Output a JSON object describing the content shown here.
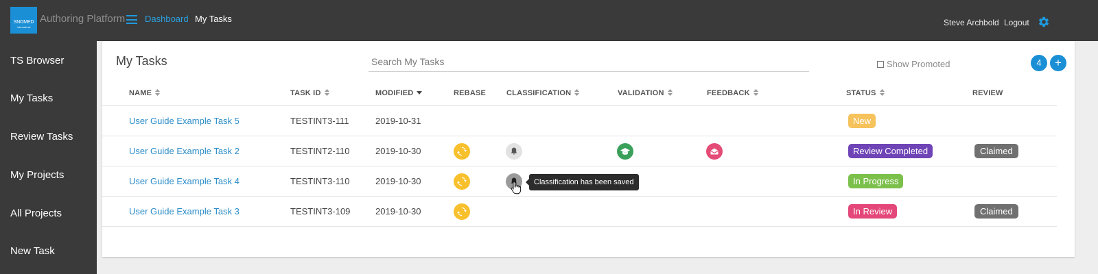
{
  "header": {
    "logo_text": "SNOMED",
    "logo_sub": "International",
    "app_title": "Authoring Platform",
    "nav": {
      "dashboard": "Dashboard",
      "current": "My Tasks"
    },
    "user_name": "Steve Archbold",
    "logout": "Logout",
    "colors": {
      "bar": "#3a3a3a",
      "accent": "#1a8fd6"
    }
  },
  "sidebar": {
    "items": [
      {
        "label": "TS Browser"
      },
      {
        "label": "My Tasks"
      },
      {
        "label": "Review Tasks"
      },
      {
        "label": "My Projects"
      },
      {
        "label": "All Projects"
      },
      {
        "label": "New Task"
      }
    ]
  },
  "main": {
    "title": "My Tasks",
    "search_placeholder": "Search My Tasks",
    "show_promoted_label": "Show Promoted",
    "task_count": "4",
    "add_label": "+",
    "columns": {
      "name": "NAME",
      "task_id": "TASK ID",
      "modified": "MODIFIED",
      "rebase": "REBASE",
      "classification": "CLASSIFICATION",
      "validation": "VALIDATION",
      "feedback": "FEEDBACK",
      "status": "STATUS",
      "review": "REVIEW"
    },
    "rows": [
      {
        "name": "User Guide Example Task 5",
        "task_id": "TESTINT3-111",
        "modified": "2019-10-31",
        "status": "New",
        "status_color": "#f6c25c"
      },
      {
        "name": "User Guide Example Task 2",
        "task_id": "TESTINT2-110",
        "modified": "2019-10-30",
        "status": "Review Completed",
        "status_color": "#6f44b6",
        "review": "Claimed"
      },
      {
        "name": "User Guide Example Task 4",
        "task_id": "TESTINT3-110",
        "modified": "2019-10-30",
        "status": "In Progress",
        "status_color": "#7cc04c"
      },
      {
        "name": "User Guide Example Task 3",
        "task_id": "TESTINT3-109",
        "modified": "2019-10-30",
        "status": "In Review",
        "status_color": "#e4477a",
        "review": "Claimed"
      }
    ],
    "tooltip": "Classification has been saved"
  }
}
